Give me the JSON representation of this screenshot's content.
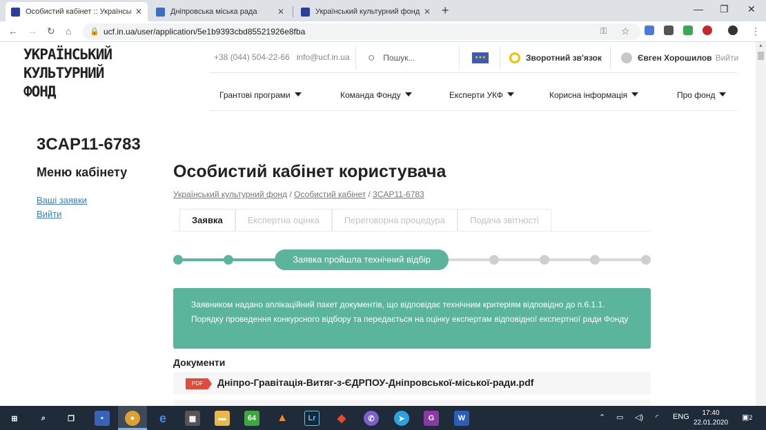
{
  "browser": {
    "tabs": [
      {
        "title": "Особистий кабінет :: Українськ",
        "active": true
      },
      {
        "title": "Дніпровська міська рада",
        "active": false
      },
      {
        "title": "Український культурний фонд",
        "active": false
      }
    ],
    "url": "ucf.in.ua/user/application/5e1b9393cbd85521926e8fba"
  },
  "header": {
    "logo": [
      "УКРАЇНСЬКИЙ",
      "КУЛЬТУРНИЙ",
      "ФОНД"
    ],
    "phone": "+38 (044) 504-22-66",
    "email": "info@ucf.in.ua",
    "search_placeholder": "Пошук...",
    "feedback": "Зворотний зв'язок",
    "user_name": "Євген Хорошилов",
    "logout": "Вийти",
    "menu": [
      "Грантові програми",
      "Команда Фонду",
      "Експерти УКФ",
      "Корисна інформація",
      "Про фонд"
    ]
  },
  "sidebar": {
    "code": "3CAP11-6783",
    "title": "Меню кабінету",
    "links": [
      "Ваші заявки",
      "Вийти"
    ]
  },
  "main": {
    "title": "Особистий кабінет користувача",
    "breadcrumbs": [
      "Український культурний фонд",
      "Особистий кабінет",
      "3CAP11-6783"
    ],
    "tabs": [
      "Заявка",
      "Експертна оцінка",
      "Переговорна процедура",
      "Подача звітності"
    ],
    "progress": {
      "current_label": "Заявка пройшла технічний відбір",
      "steps_total": 9,
      "current_step": 3
    },
    "notice": "Заявником надано аплікаційний пакет документів, що відповідає технічним критеріям відповідно до п.6.1.1. Порядку проведення конкурсного відбору та передається на оцінку експертам відповідної експертної ради Фонду",
    "documents_title": "Документи",
    "documents": [
      {
        "badge": "PDF",
        "name": "Дніпро-Гравітація-Витяг-з-ЄДРПОУ-Дніпровської-міської-ради.pdf"
      }
    ]
  },
  "taskbar": {
    "lang": "ENG",
    "time": "17:40",
    "date": "22.01.2020",
    "notifications": "2",
    "lastpass_badge": "64"
  },
  "colors": {
    "accent": "#5bb59c",
    "link": "#3b7fc4",
    "pdf": "#e14b3b"
  }
}
